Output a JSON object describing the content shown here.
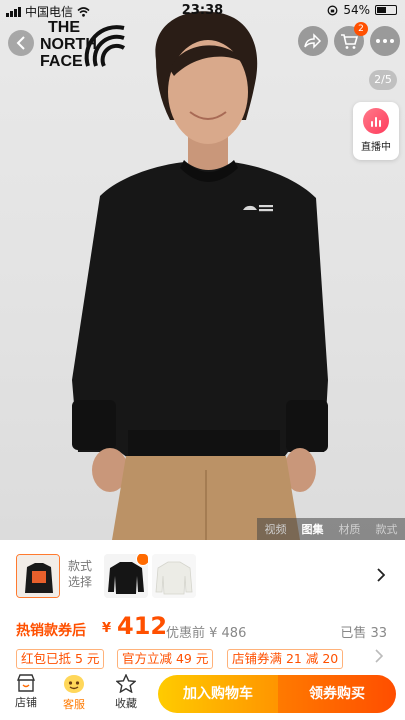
{
  "status_bar": {
    "carrier": "中国电信",
    "time": "23:38",
    "battery": "54%",
    "battery_level": 0.54
  },
  "header": {
    "brand_logo": [
      "THE",
      "NORTH",
      "FACE"
    ],
    "icons": [
      "back-icon",
      "share-icon",
      "cart-icon",
      "more-icon"
    ],
    "cart_count": "2"
  },
  "gallery": {
    "page_indicator": "2/5",
    "live_label": "直播中",
    "tabs": [
      {
        "label": "视频",
        "active": false
      },
      {
        "label": "图集",
        "active": true
      },
      {
        "label": "材质",
        "active": false
      },
      {
        "label": "款式",
        "active": false
      }
    ]
  },
  "variants": {
    "label": "款式选择",
    "colors": [
      "#151515",
      "#151515",
      "#ecece6"
    ]
  },
  "price": {
    "promo_label": "热销款券后",
    "currency": "¥",
    "value": "412",
    "original": "优惠前 ¥ 486",
    "sold": "已售 33"
  },
  "coupons": [
    {
      "label": "红包已抵 5 元"
    },
    {
      "label": "官方立减 49 元"
    },
    {
      "label": "店铺券满 21 减 20"
    }
  ],
  "bottom_bar": {
    "store_label": "店铺",
    "service_label": "客服",
    "favorite_label": "收藏",
    "add_cart_label": "加入购物车",
    "buy_label": "领券购买"
  },
  "colors": {
    "accent": "#ff5000",
    "add_cart": "#ffb000",
    "buy": "#ff6000"
  }
}
